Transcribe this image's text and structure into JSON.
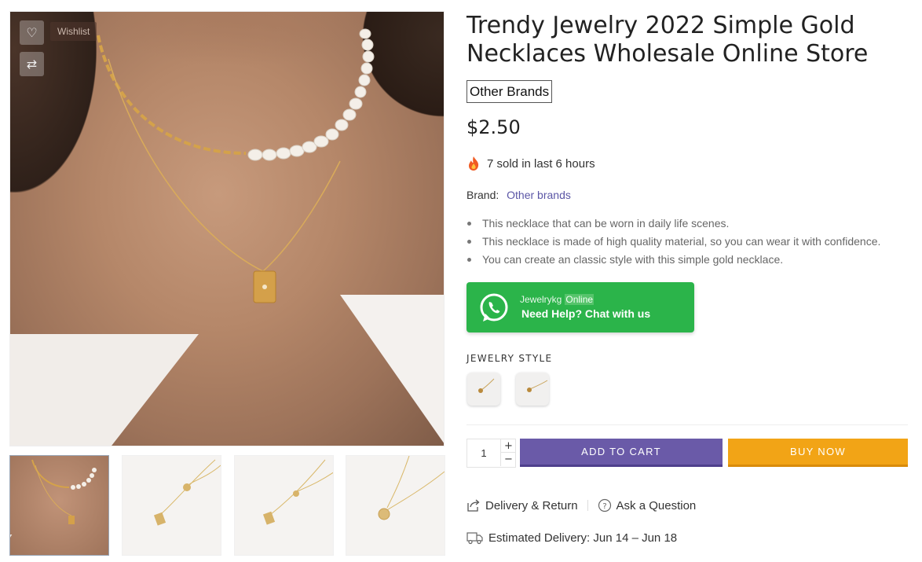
{
  "gallery": {
    "wishlist_tooltip": "Wishlist",
    "icons": [
      "heart-icon",
      "compare-icon"
    ],
    "thumbnail_count": 4
  },
  "product": {
    "title": "Trendy Jewelry 2022 Simple Gold Necklaces Wholesale Online Store",
    "brand_badge": "Other Brands",
    "price": "$2.50",
    "sold_text": "7 sold in last 6 hours",
    "brand_label": "Brand:",
    "brand_value": "Other brands",
    "features": [
      "This necklace that can be worn in daily life scenes.",
      "This necklace is made of high quality material, so you can wear it with confidence.",
      "You can create an classic style with this simple gold necklace."
    ]
  },
  "whatsapp": {
    "name": "Jewelrykg",
    "status": "Online",
    "help_text": "Need Help? Chat with us",
    "color": "#2bb44a"
  },
  "variants": {
    "label": "JEWELRY STYLE",
    "swatch_count": 2
  },
  "cart": {
    "quantity": "1",
    "plus": "+",
    "minus": "−",
    "add_to_cart": "ADD TO CART",
    "buy_now": "BUY NOW",
    "add_color": "#6a5aa8",
    "buy_color": "#f2a416"
  },
  "links": {
    "delivery_return": "Delivery & Return",
    "ask_question": "Ask a Question",
    "estimated_delivery": "Estimated Delivery: Jun 14 – Jun 18"
  }
}
